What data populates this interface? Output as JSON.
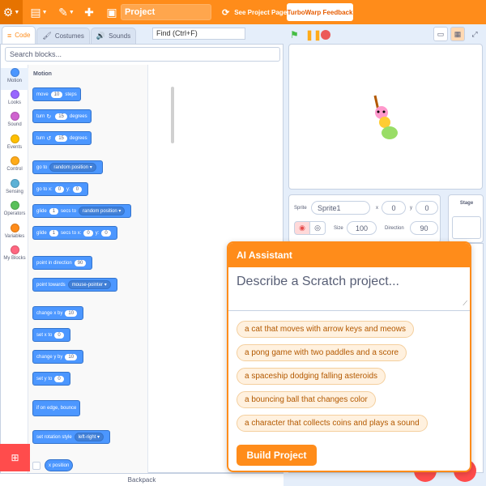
{
  "menubar": {
    "project_title": "Project",
    "see_project": "See Project Page",
    "feedback": "TurboWarp Feedback"
  },
  "tabs": [
    {
      "label": "Code",
      "icon": "code-icon"
    },
    {
      "label": "Costumes",
      "icon": "brush-icon"
    },
    {
      "label": "Sounds",
      "icon": "speaker-icon"
    }
  ],
  "find_placeholder": "Find (Ctrl+F)",
  "search_blocks_placeholder": "Search blocks...",
  "categories": [
    {
      "label": "Motion",
      "color": "#4c97ff"
    },
    {
      "label": "Looks",
      "color": "#9966ff"
    },
    {
      "label": "Sound",
      "color": "#cf63cf"
    },
    {
      "label": "Events",
      "color": "#ffbf00"
    },
    {
      "label": "Control",
      "color": "#ffab19"
    },
    {
      "label": "Sensing",
      "color": "#5cb1d6"
    },
    {
      "label": "Operators",
      "color": "#59c059"
    },
    {
      "label": "Variables",
      "color": "#ff8c1a"
    },
    {
      "label": "My Blocks",
      "color": "#ff6680"
    }
  ],
  "palette": {
    "title": "Motion",
    "blocks": {
      "move": {
        "a": "move",
        "v": "10",
        "b": "steps"
      },
      "turn_right": {
        "a": "turn",
        "v": "15",
        "b": "degrees"
      },
      "turn_left": {
        "a": "turn",
        "v": "15",
        "b": "degrees"
      },
      "goto": {
        "a": "go to",
        "dd": "random position"
      },
      "gotoxy": {
        "a": "go to x:",
        "x": "0",
        "b": "y:",
        "y": "0"
      },
      "glide_to": {
        "a": "glide",
        "v": "1",
        "b": "secs to",
        "dd": "random position"
      },
      "glide_xy": {
        "a": "glide",
        "v": "1",
        "b": "secs to x:",
        "x": "0",
        "c": "y:",
        "y": "0"
      },
      "point_dir": {
        "a": "point in direction",
        "v": "90"
      },
      "point_towards": {
        "a": "point towards",
        "dd": "mouse-pointer"
      },
      "change_x": {
        "a": "change x by",
        "v": "10"
      },
      "set_x": {
        "a": "set x to",
        "v": "0"
      },
      "change_y": {
        "a": "change y by",
        "v": "10"
      },
      "set_y": {
        "a": "set y to",
        "v": "0"
      },
      "bounce": {
        "a": "if on edge, bounce"
      },
      "rot_style": {
        "a": "set rotation style",
        "dd": "left-right"
      },
      "x_position": {
        "a": "x position"
      }
    }
  },
  "backpack": "Backpack",
  "sprite": {
    "label": "Sprite",
    "name": "Sprite1",
    "x_label": "x",
    "x": "0",
    "y_label": "y",
    "y": "0",
    "size_label": "Size",
    "size": "100",
    "direction_label": "Direction",
    "direction": "90"
  },
  "stage_panel": {
    "label": "Stage"
  },
  "ai": {
    "title": "AI Assistant",
    "placeholder": "Describe a Scratch project...",
    "suggestions": [
      "a cat that moves with arrow keys and meows",
      "a pong game with two paddles and a score",
      "a spaceship dodging falling asteroids",
      "a bouncing ball that changes color",
      "a character that collects coins and plays a sound"
    ],
    "build_label": "Build Project"
  }
}
